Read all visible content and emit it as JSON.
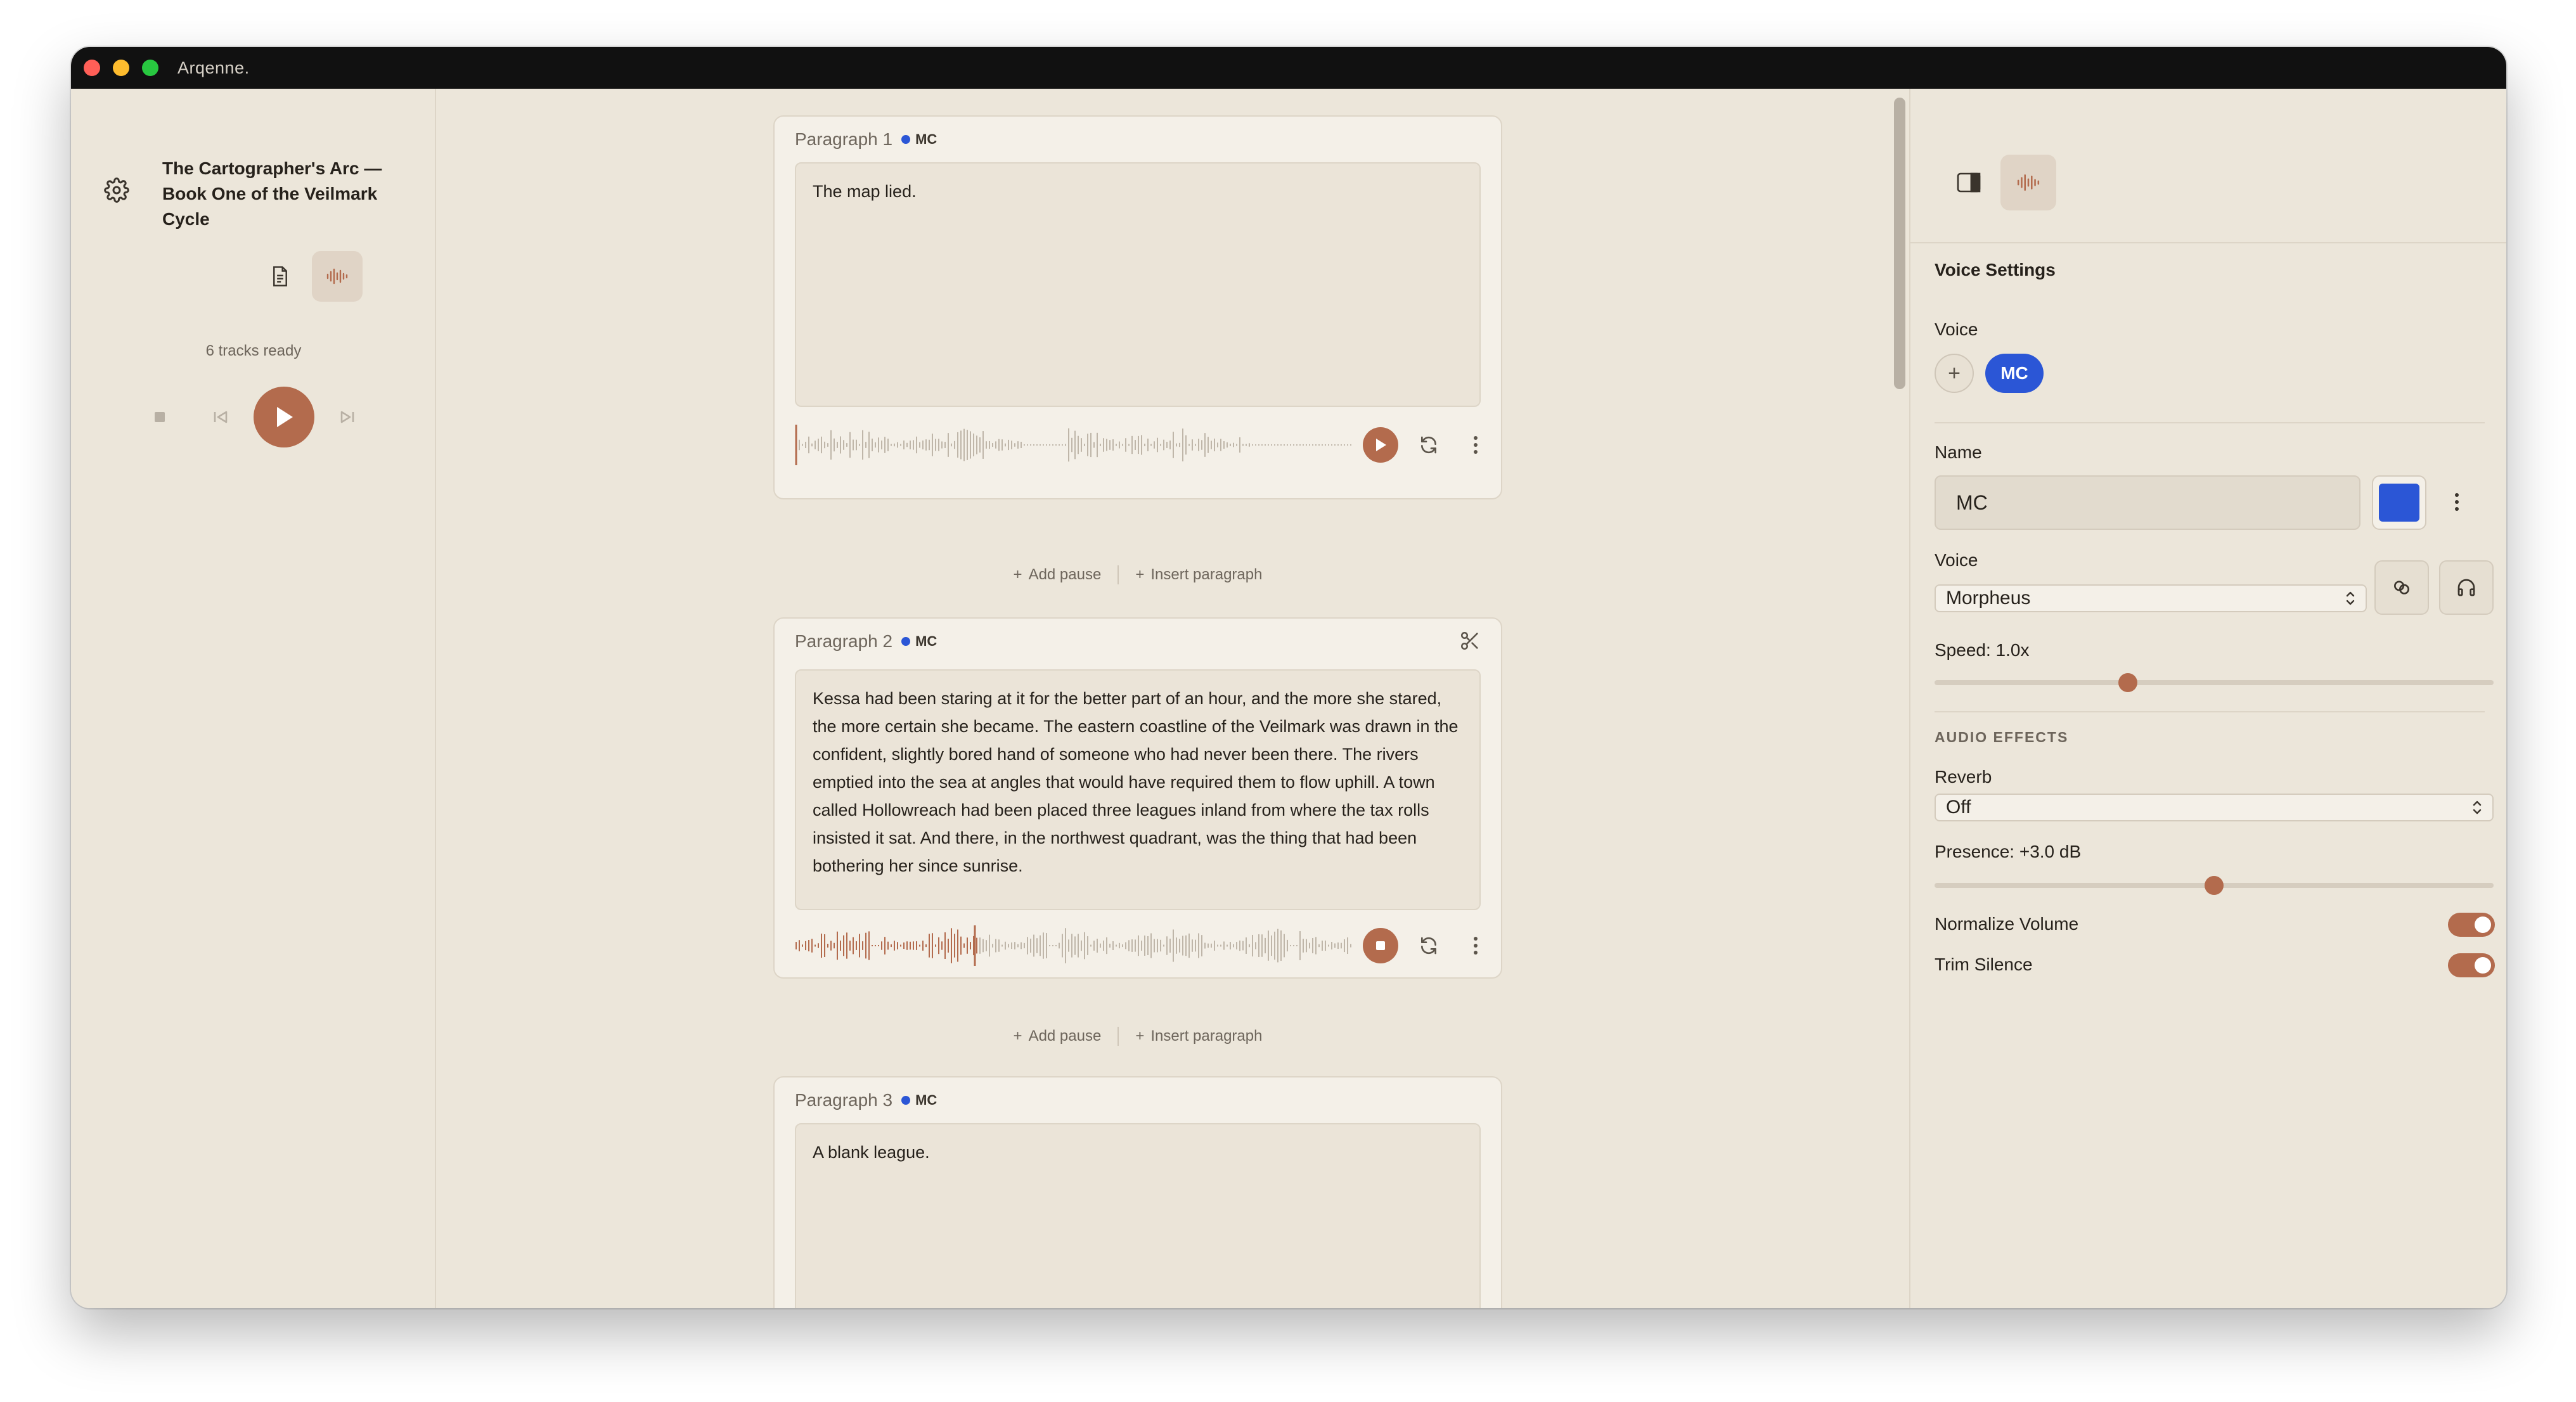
{
  "app": {
    "title": "Arqenne."
  },
  "sidebar": {
    "book_title": "The Cartographer's Arc — Book One of the Veilmark Cycle",
    "tracks_status": "6 tracks ready",
    "view_modes": [
      {
        "icon": "document-icon",
        "active": false
      },
      {
        "icon": "waveform-icon",
        "active": true
      }
    ]
  },
  "editor": {
    "paragraphs": [
      {
        "label": "Paragraph 1",
        "voice": "MC",
        "voice_color": "#2b56d6",
        "text": "The map lied.",
        "playback": "stopped"
      },
      {
        "label": "Paragraph 2",
        "voice": "MC",
        "voice_color": "#2b56d6",
        "text": "Kessa had been staring at it for the better part of an hour, and the more she stared, the more certain she became. The eastern coastline of the Veilmark was drawn in the confident, slightly bored hand of someone who had never been there. The rivers emptied into the sea at angles that would have required them to flow uphill. A town called Hollowreach had been placed three leagues inland from where the tax rolls insisted it sat. And there, in the northwest quadrant, was the thing that had been bothering her since sunrise.",
        "playback": "playing"
      },
      {
        "label": "Paragraph 3",
        "voice": "MC",
        "voice_color": "#2b56d6",
        "text": "A blank league."
      }
    ],
    "between_actions": {
      "add_pause": "Add pause",
      "insert_paragraph": "Insert paragraph"
    }
  },
  "panel": {
    "heading": "Voice Settings",
    "voice_label": "Voice",
    "add_voice": "+",
    "selected_voice_chip": "MC",
    "name_label": "Name",
    "name_value": "MC",
    "voice_color": "#2b56d6",
    "voice_model_label": "Voice",
    "voice_model": "Morpheus",
    "speed_label": "Speed: 1.0x",
    "speed_fraction": 0.34,
    "audio_effects_label": "AUDIO EFFECTS",
    "reverb_label": "Reverb",
    "reverb_value": "Off",
    "presence_label": "Presence: +3.0 dB",
    "presence_fraction": 0.5,
    "normalize_label": "Normalize Volume",
    "normalize_on": true,
    "trim_label": "Trim Silence",
    "trim_on": true
  },
  "colors": {
    "accent": "#b36b4d",
    "voice_blue": "#2b56d6",
    "background": "#ece6da"
  }
}
